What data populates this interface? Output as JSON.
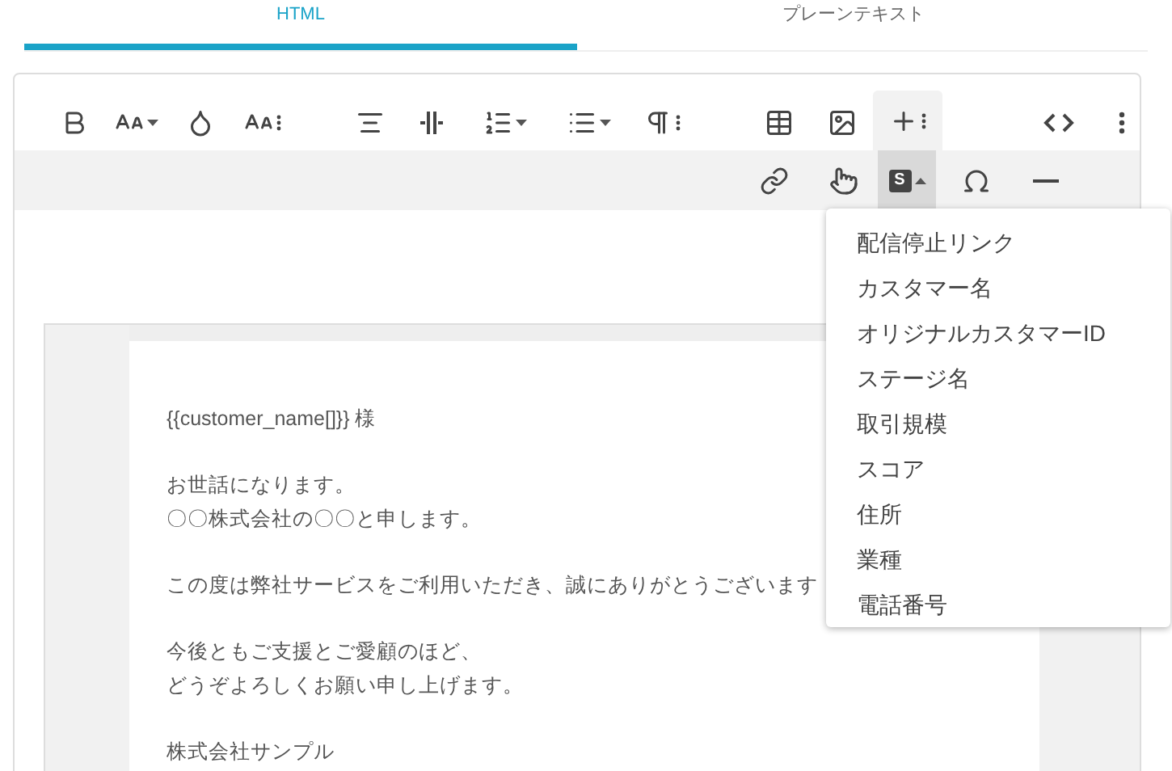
{
  "tabs": [
    {
      "label": "HTML",
      "selected": true
    },
    {
      "label": "プレーンテキスト",
      "selected": false
    }
  ],
  "toolbar": {
    "row_1": [
      {
        "active": false
      },
      {
        "active": false
      },
      {
        "active": false
      },
      {
        "active": false
      },
      {
        "active": false
      },
      {
        "active": false
      },
      {
        "active": false
      },
      {
        "active": false
      },
      {
        "active": false
      },
      {
        "active": false
      },
      {
        "active": false
      },
      {
        "active": true
      },
      {
        "active": false
      },
      {
        "active": false
      }
    ],
    "row_2": [
      {
        "active": false
      },
      {
        "active": false
      },
      {
        "active": true,
        "label": "S"
      },
      {
        "active": false
      },
      {
        "active": false
      }
    ]
  },
  "dropdown_menu": {
    "items": [
      "配信停止リンク",
      "カスタマー名",
      "オリジナルカスタマーID",
      "ステージ名",
      "取引規模",
      "スコア",
      "住所",
      "業種",
      "電話番号"
    ]
  },
  "email_body": {
    "paragraphs": [
      [
        "{{customer_name[]}} 様"
      ],
      [
        "お世話になります。",
        "〇〇株式会社の〇〇と申します。"
      ],
      [
        "この度は弊社サービスをご利用いただき、誠にありがとうございます"
      ],
      [
        "今後ともご支援とご愛顧のほど、",
        "どうぞよろしくお願い申し上げます。"
      ],
      [
        "株式会社サンプル"
      ]
    ]
  }
}
